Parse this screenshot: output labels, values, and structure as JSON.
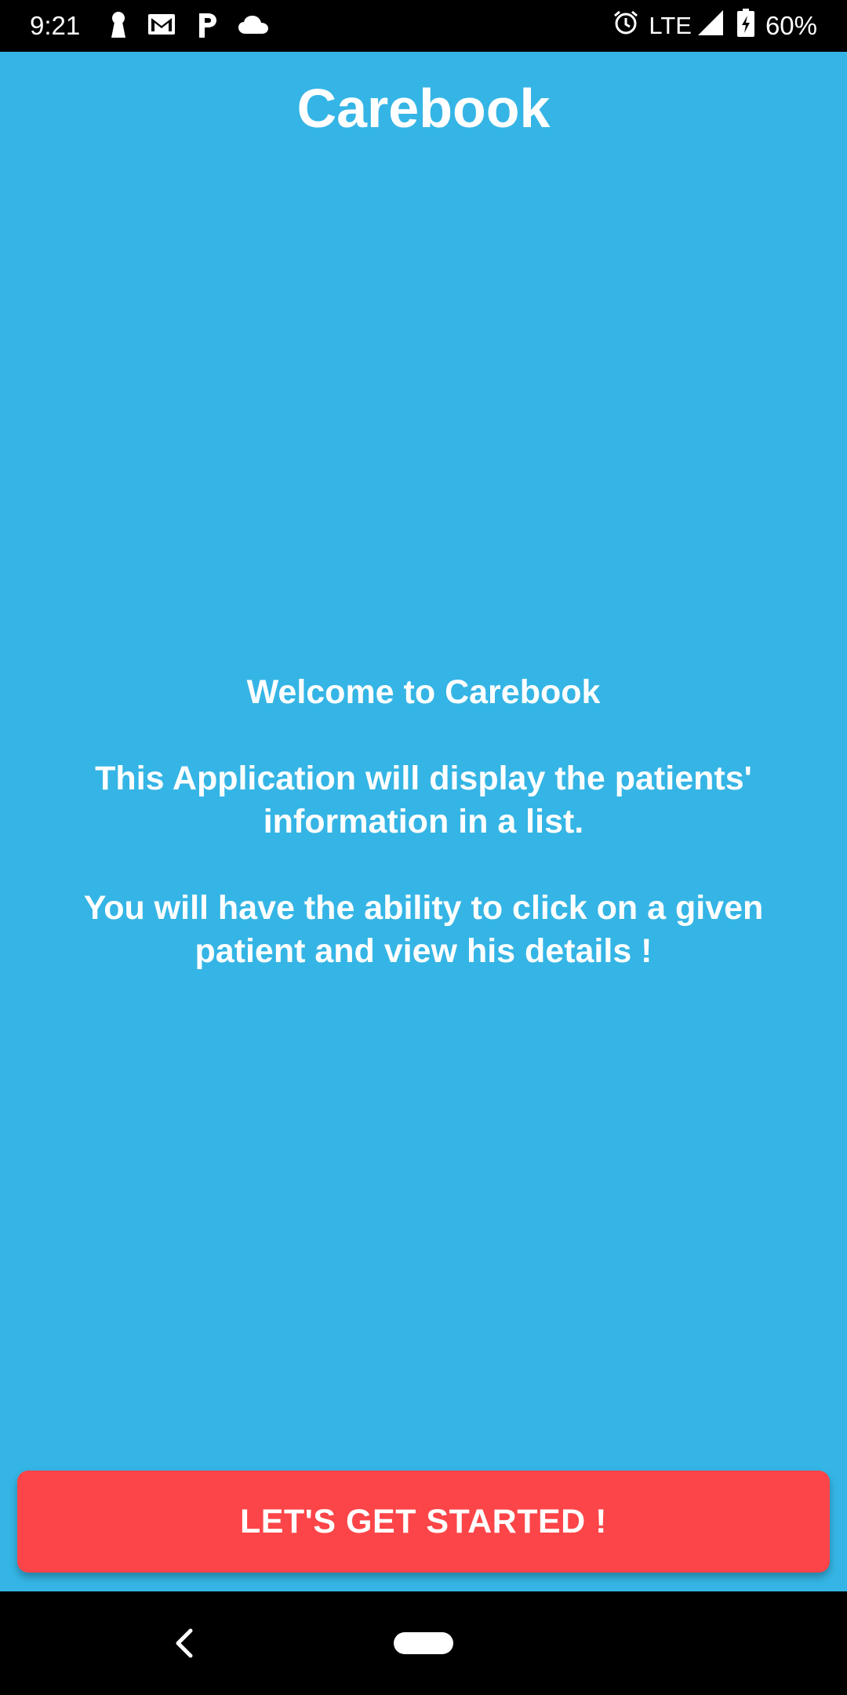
{
  "status_bar": {
    "time": "9:21",
    "left_icons": [
      "keyhole-icon",
      "gmail-icon",
      "p-icon",
      "cloud-icon"
    ],
    "network": "LTE",
    "battery_percent": "60%",
    "right_icons": [
      "alarm-icon",
      "signal-icon",
      "battery-charging-icon"
    ]
  },
  "app": {
    "title": "Carebook"
  },
  "welcome": {
    "line1": "Welcome to Carebook",
    "line2": "This Application will display the patients' information in a list.",
    "line3": "You will have the ability to click on a given patient and view his details !"
  },
  "cta": {
    "label": "LET'S GET STARTED !"
  },
  "nav": {
    "icons": [
      "back-icon",
      "home-pill-icon"
    ]
  },
  "colors": {
    "background": "#35b5e5",
    "button": "#fc4548",
    "text": "#ffffff",
    "bars": "#000000"
  }
}
